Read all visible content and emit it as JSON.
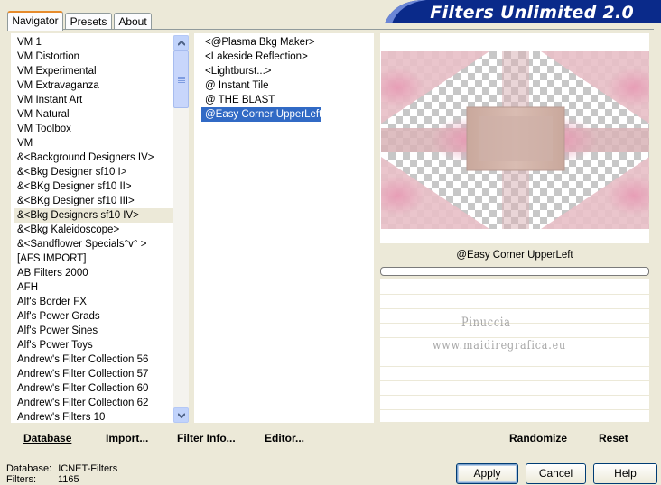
{
  "app": {
    "title": "Filters Unlimited 2.0"
  },
  "tabs": [
    {
      "label": "Navigator",
      "active": true
    },
    {
      "label": "Presets",
      "active": false
    },
    {
      "label": "About",
      "active": false
    }
  ],
  "categories": {
    "items": [
      "VM 1",
      "VM Distortion",
      "VM Experimental",
      "VM Extravaganza",
      "VM Instant Art",
      "VM Natural",
      "VM Toolbox",
      "VM",
      "&<Background Designers IV>",
      "&<Bkg Designer sf10 I>",
      "&<BKg Designer sf10 II>",
      "&<BKg Designer sf10 III>",
      "&<Bkg Designers sf10 IV>",
      "&<Bkg Kaleidoscope>",
      "&<Sandflower Specials°v° >",
      "[AFS IMPORT]",
      "AB Filters 2000",
      "AFH",
      "Alf's Border FX",
      "Alf's Power Grads",
      "Alf's Power Sines",
      "Alf's Power Toys",
      "Andrew's Filter Collection 56",
      "Andrew's Filter Collection 57",
      "Andrew's Filter Collection 60",
      "Andrew's Filter Collection 62",
      "Andrew's Filters 10"
    ],
    "highlighted_index": 12
  },
  "filters": {
    "items": [
      "<@Plasma Bkg Maker>",
      "<Lakeside Reflection>",
      "<Lightburst...>",
      "@ Instant Tile",
      "@ THE BLAST",
      "@Easy Corner UpperLeft"
    ],
    "selected_index": 5
  },
  "preview": {
    "filter_name": "@Easy Corner UpperLeft",
    "progress": 0
  },
  "watermark": {
    "line1": "Pinuccia",
    "line2": "www.maidiregrafica.eu"
  },
  "toolbar": {
    "database": "Database",
    "import": "Import...",
    "filter_info": "Filter Info...",
    "editor": "Editor...",
    "randomize": "Randomize",
    "reset": "Reset"
  },
  "status": {
    "database_label": "Database:",
    "database_value": "ICNET-Filters",
    "filters_label": "Filters:",
    "filters_value": "1165"
  },
  "buttons": {
    "apply": "Apply",
    "cancel": "Cancel",
    "help": "Help"
  },
  "colors": {
    "title_band": "#0a2a8a",
    "selection": "#316ac5",
    "tab_accent": "#e68b2c"
  }
}
